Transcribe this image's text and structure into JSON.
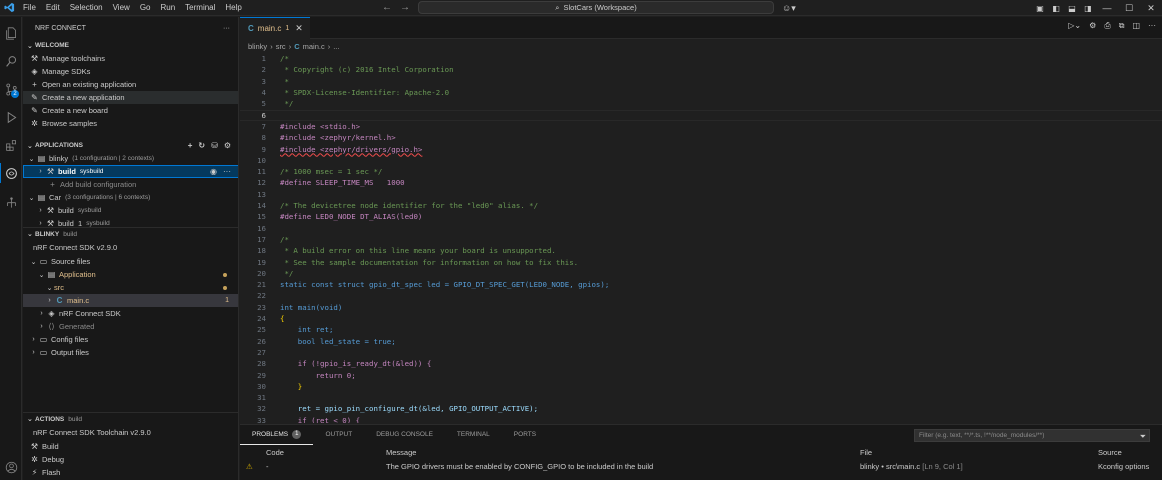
{
  "menu": [
    "File",
    "Edit",
    "Selection",
    "View",
    "Go",
    "Run",
    "Terminal",
    "Help"
  ],
  "command_center": "SlotCars (Workspace)",
  "sidebar": {
    "title": "NRF CONNECT",
    "welcome": {
      "header": "WELCOME",
      "items": [
        "Manage toolchains",
        "Manage SDKs",
        "Open an existing application",
        "Create a new application",
        "Create a new board",
        "Browse samples"
      ]
    },
    "applications": {
      "header": "APPLICATIONS",
      "blinky": "blinky",
      "blinky_meta": "(1 configuration | 2 contexts)",
      "build": "build",
      "build_tag": "sysbuild",
      "add_build": "Add build configuration",
      "car": "Car",
      "car_meta": "(3 configurations | 6 contexts)",
      "car_build": "build",
      "car_build_tag": "sysbuild",
      "car_build1": "build_1",
      "car_build1_tag": "sysbuild"
    },
    "blinky_section": {
      "header": "BLINKY",
      "sub": "build",
      "sdk": "nRF Connect SDK v2.9.0",
      "source_files": "Source files",
      "application": "Application",
      "src": "src",
      "main_c": "main.c",
      "main_c_count": "1",
      "ncs": "nRF Connect SDK",
      "generated": "Generated",
      "config_files": "Config files",
      "output_files": "Output files"
    },
    "actions": {
      "header": "ACTIONS",
      "sub": "build",
      "toolchain": "nRF Connect SDK Toolchain v2.9.0",
      "items": [
        "Build",
        "Debug",
        "Flash"
      ]
    }
  },
  "tab": {
    "name": "main.c",
    "count": "1",
    "lang_icon": "C"
  },
  "breadcrumb": [
    "blinky",
    "src",
    "main.c",
    "..."
  ],
  "code_lines": [
    "/*",
    " * Copyright (c) 2016 Intel Corporation",
    " *",
    " * SPDX-License-Identifier: Apache-2.0",
    " */",
    "",
    "#include <stdio.h>",
    "#include <zephyr/kernel.h>",
    "#include <zephyr/drivers/gpio.h>",
    "",
    "/* 1000 msec = 1 sec */",
    "#define SLEEP_TIME_MS   1000",
    "",
    "/* The devicetree node identifier for the \"led0\" alias. */",
    "#define LED0_NODE DT_ALIAS(led0)",
    "",
    "/*",
    " * A build error on this line means your board is unsupported.",
    " * See the sample documentation for information on how to fix this.",
    " */",
    "static const struct gpio_dt_spec led = GPIO_DT_SPEC_GET(LED0_NODE, gpios);",
    "",
    "int main(void)",
    "{",
    "    int ret;",
    "    bool led_state = true;",
    "",
    "    if (!gpio_is_ready_dt(&led)) {",
    "        return 0;",
    "    }",
    "",
    "    ret = gpio_pin_configure_dt(&led, GPIO_OUTPUT_ACTIVE);",
    "    if (ret < 0) {"
  ],
  "panel": {
    "tabs": [
      "PROBLEMS",
      "OUTPUT",
      "DEBUG CONSOLE",
      "TERMINAL",
      "PORTS"
    ],
    "problems_count": "1",
    "filter_placeholder": "Filter (e.g. text, **/*.ts, !**/node_modules/**)",
    "headers": {
      "code": "Code",
      "message": "Message",
      "file": "File",
      "source": "Source"
    },
    "problem": {
      "code": "-",
      "message": "The GPIO drivers must be enabled by CONFIG_GPIO to be included in the build",
      "file": "blinky • src\\main.c",
      "position": "[Ln 9, Col 1]",
      "source": "Kconfig options"
    }
  }
}
